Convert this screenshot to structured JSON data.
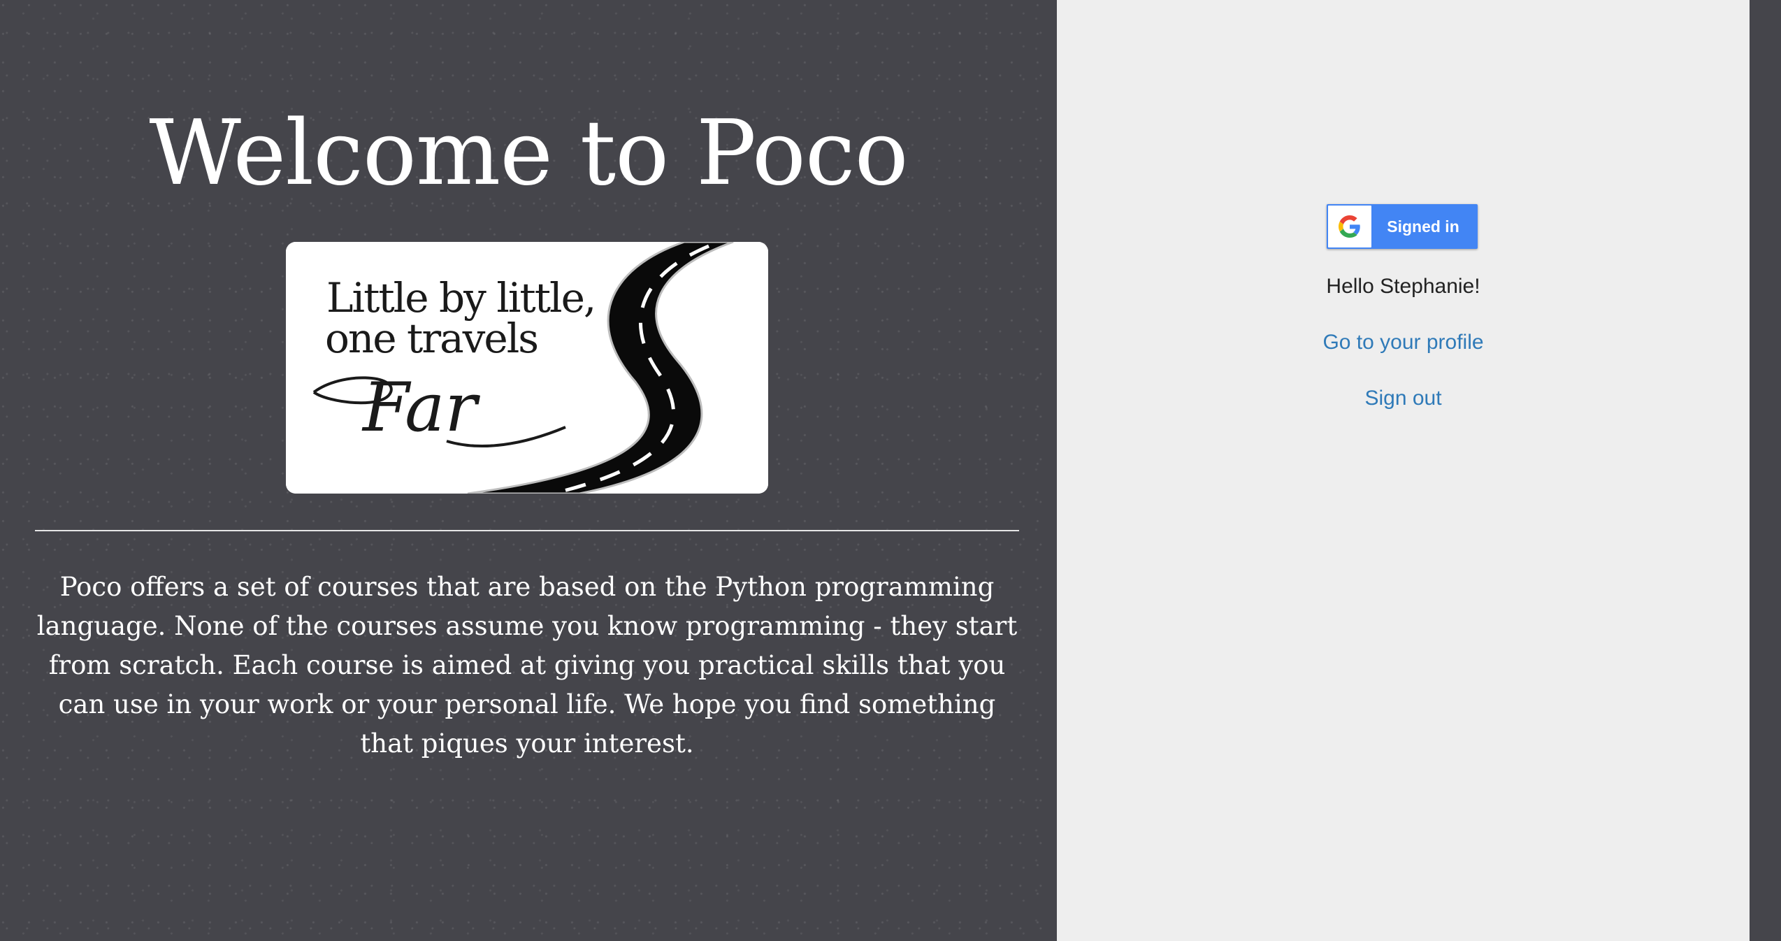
{
  "hero": {
    "title": "Welcome to Poco",
    "image_text": {
      "line1": "Little by little,",
      "line2": "one travels",
      "line3": "Far"
    },
    "description": "Poco offers a set of courses that are based on the Python programming language. None of the courses assume you know programming - they start from scratch. Each course is aimed at giving you practical skills that you can use in your work or your personal life. We hope you find something that piques your interest."
  },
  "auth": {
    "signin_button_label": "Signed in",
    "signin_icon": "google-g-icon",
    "greeting": "Hello Stephanie!",
    "profile_link": "Go to your profile",
    "signout_link": "Sign out"
  },
  "colors": {
    "dark_background": "#45454b",
    "light_panel": "#eeeeee",
    "google_blue": "#4285f4",
    "link_blue": "#2f7ab8"
  }
}
